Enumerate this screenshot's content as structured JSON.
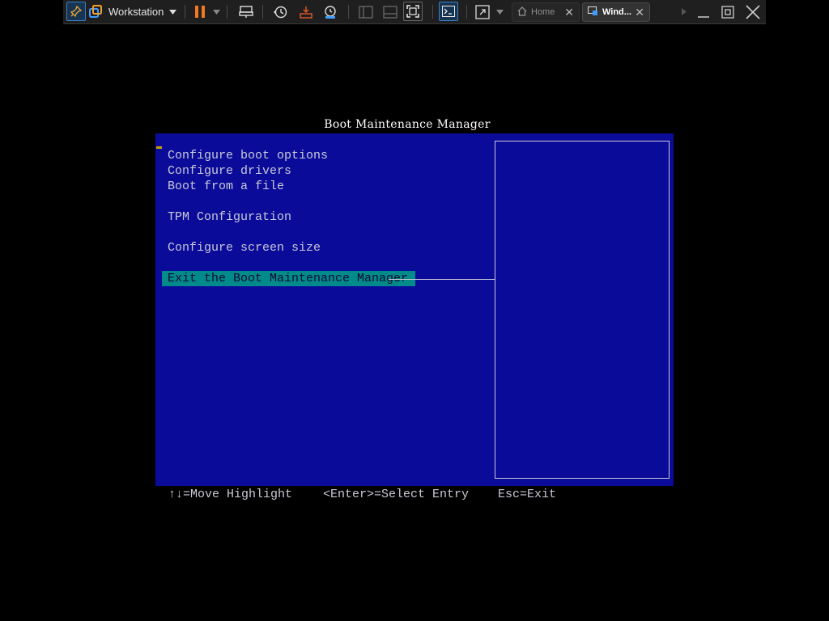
{
  "toolbar": {
    "product_label": "Workstation",
    "tabs": [
      {
        "label": "Home"
      },
      {
        "label": "Wind..."
      }
    ]
  },
  "bios": {
    "title": "Boot Maintenance Manager",
    "menu": [
      "Configure boot options",
      "Configure drivers",
      "Boot from a file",
      "TPM Configuration",
      "Configure screen size",
      "Exit the Boot Maintenance Manager"
    ],
    "selected_index": 5,
    "footer": {
      "move": "↑↓=Move Highlight",
      "select": "<Enter>=Select Entry",
      "exit": "Esc=Exit"
    }
  },
  "colors": {
    "bios_blue": "#0b0b9a",
    "highlight": "#008a8a",
    "text": "#c9c9d7"
  }
}
